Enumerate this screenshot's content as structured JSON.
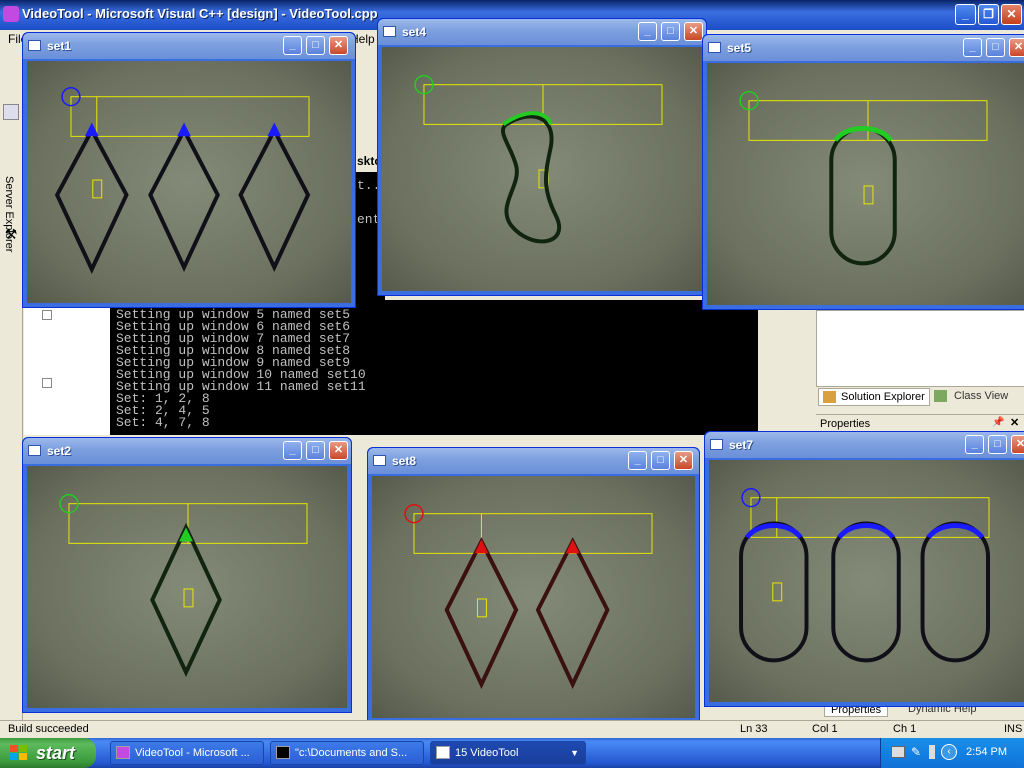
{
  "vs": {
    "title": "VideoTool - Microsoft Visual C++ [design] - VideoTool.cpp",
    "menu_file": "File",
    "menu_help": "Help",
    "server_explorer": "Server Explorer",
    "solution_explorer": "Solution Explorer",
    "class_view": "Class View",
    "properties": "Properties",
    "properties_tab": "Properties",
    "dynamic_help": "Dynamic Help",
    "desktop_partial": "sktop",
    "console_partial_1": "t..",
    "console_partial_2": "ent"
  },
  "console": {
    "lines": [
      "Setting up window 5 named set5",
      "Setting up window 6 named set6",
      "Setting up window 7 named set7",
      "Setting up window 8 named set8",
      "Setting up window 9 named set9",
      "Setting up window 10 named set10",
      "Setting up window 11 named set11",
      "Set: 1, 2, 8",
      "Set: 2, 4, 5",
      "Set: 4, 7, 8"
    ]
  },
  "windows": {
    "set1": "set1",
    "set2": "set2",
    "set4": "set4",
    "set5": "set5",
    "set7": "set7",
    "set8": "set8"
  },
  "status": {
    "message": "Build succeeded",
    "line": "Ln 33",
    "col": "Col 1",
    "ch": "Ch 1",
    "mode": "INS"
  },
  "taskbar": {
    "start": "start",
    "task1": "VideoTool - Microsoft ...",
    "task2": "\"c:\\Documents and S...",
    "task3": "15 VideoTool",
    "clock": "2:54 PM"
  },
  "colors": {
    "blue": "#1a1aff",
    "green": "#22cc22",
    "red": "#dd1111",
    "yellow": "#e8e800"
  }
}
